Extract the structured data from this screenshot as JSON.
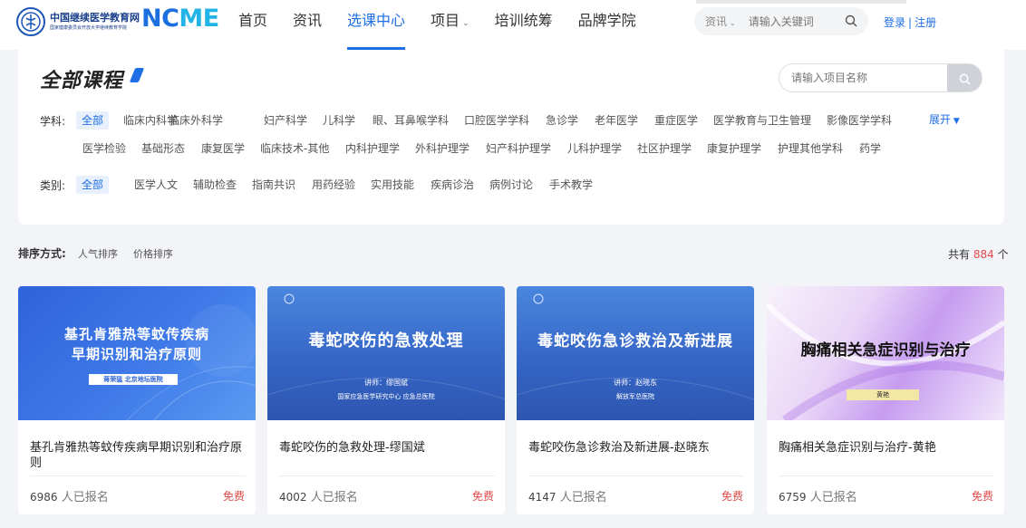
{
  "header": {
    "logo_cn": "中国继续医学教育网",
    "logo_sub": "国家健康委员会开放大学继续教育学院",
    "brand_a": "NC",
    "brand_b": "ME",
    "nav": [
      {
        "label": "首页"
      },
      {
        "label": "资讯"
      },
      {
        "label": "选课中心",
        "active": true
      },
      {
        "label": "项目",
        "has_caret": true
      },
      {
        "label": "培训统筹"
      },
      {
        "label": "品牌学院"
      }
    ],
    "search_select": "资讯",
    "search_placeholder": "请输入关键词",
    "login": "登录",
    "register": "注册"
  },
  "filter": {
    "title": "全部课程",
    "project_search_placeholder": "请输入项目名称",
    "subject_label": "学科:",
    "subjects_row1": [
      "全部",
      "临床内科学",
      "临床外科学",
      "妇产科学",
      "儿科学",
      "眼、耳鼻喉学科",
      "口腔医学学科",
      "急诊学",
      "老年医学",
      "重症医学",
      "医学教育与卫生管理",
      "影像医学学科"
    ],
    "subjects_row2": [
      "医学检验",
      "基础形态",
      "康复医学",
      "临床技术-其他",
      "内科护理学",
      "外科护理学",
      "妇产科护理学",
      "儿科护理学",
      "社区护理学",
      "康复护理学",
      "护理其他学科",
      "药学"
    ],
    "expand_label": "展开",
    "category_label": "类别:",
    "categories": [
      "全部",
      "医学人文",
      "辅助检查",
      "指南共识",
      "用药经验",
      "实用技能",
      "疾病诊治",
      "病例讨论",
      "手术教学"
    ]
  },
  "sort": {
    "label": "排序方式:",
    "options": [
      "人气排序",
      "价格排序"
    ],
    "total_prefix": "共有",
    "total": "884",
    "total_suffix": "个"
  },
  "courses": [
    {
      "cover_title_1": "基孔肯雅热等蚊传疾病",
      "cover_title_2": "早期识别和治疗原则",
      "cover_speaker": "蒋荣猛   北京地坛医院",
      "name": "基孔肯雅热等蚊传疾病早期识别和治疗原则",
      "count": "6986",
      "count_suffix": "人已报名",
      "price": "免费"
    },
    {
      "cover_title_1": "毒蛇咬伤的急救处理",
      "cover_speaker": "讲师：缪国斌",
      "cover_org": "国家应急医学研究中心 应急总医院",
      "name": "毒蛇咬伤的急救处理-缪国斌",
      "count": "4002",
      "count_suffix": "人已报名",
      "price": "免费"
    },
    {
      "cover_title_1": "毒蛇咬伤急诊救治及新进展",
      "cover_speaker": "讲师：赵晓东",
      "cover_org": "解放军总医院",
      "name": "毒蛇咬伤急诊救治及新进展-赵晓东",
      "count": "4147",
      "count_suffix": "人已报名",
      "price": "免费"
    },
    {
      "cover_title_1": "胸痛相关急症识别与治疗",
      "cover_speaker": "黄艳",
      "name": "胸痛相关急症识别与治疗-黄艳",
      "count": "6759",
      "count_suffix": "人已报名",
      "price": "免费"
    }
  ],
  "colors": {
    "accent": "#1e6ee6",
    "price": "#e04a4a",
    "brand": "#1d6fe0"
  }
}
